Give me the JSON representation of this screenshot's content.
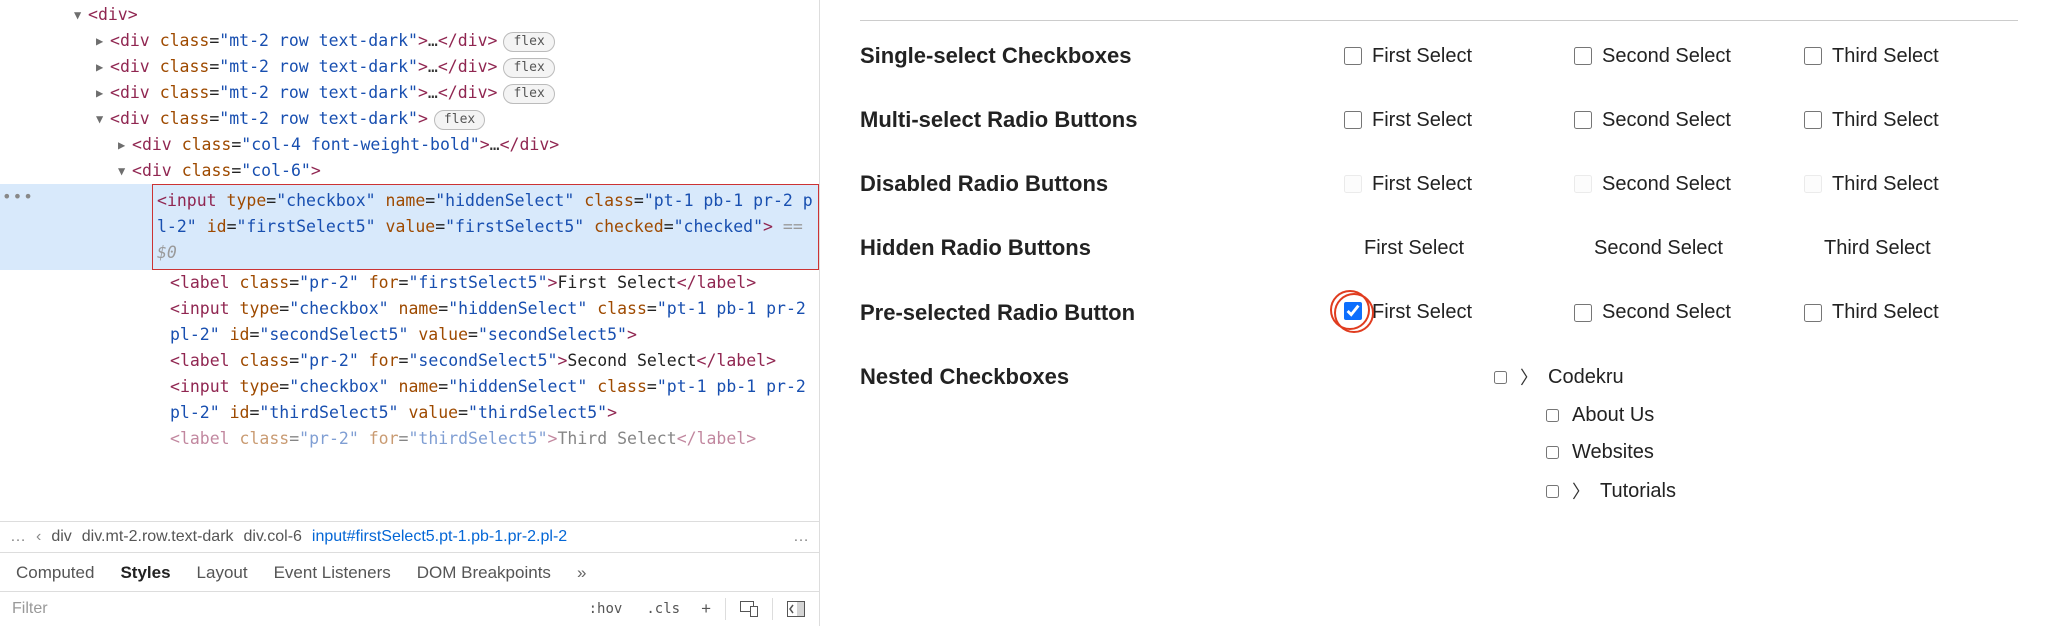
{
  "dom": {
    "root_open": "<div>",
    "rows": [
      {
        "open": "<div class=\"mt-2 row text-dark\">",
        "close": "</div>"
      },
      {
        "open": "<div class=\"mt-2 row text-dark\">",
        "close": "</div>"
      },
      {
        "open": "<div class=\"mt-2 row text-dark\">",
        "close": "</div>"
      },
      {
        "open": "<div class=\"mt-2 row text-dark\">",
        "close": ""
      }
    ],
    "child1": {
      "open": "<div class=\"col-4 font-weight-bold\">",
      "close": "</div>"
    },
    "child2_open": "<div class=\"col-6\">",
    "selected_input": "<input type=\"checkbox\" name=\"hiddenSelect\" class=\"pt-1 pb-1 pr-2 pl-2\" id=\"firstSelect5\" value=\"firstSelect5\" checked=\"checked\">",
    "ghost": " == $0",
    "label1": "<label class=\"pr-2\" for=\"firstSelect5\">First Select</label>",
    "input2": "<input type=\"checkbox\" name=\"hiddenSelect\" class=\"pt-1 pb-1 pr-2 pl-2\" id=\"secondSelect5\" value=\"secondSelect5\">",
    "label2": "<label class=\"pr-2\" for=\"secondSelect5\">Second Select</label>",
    "input3": "<input type=\"checkbox\" name=\"hiddenSelect\" class=\"pt-1 pb-1 pr-2 pl-2\" id=\"thirdSelect5\" value=\"thirdSelect5\">",
    "label3_partial": "<label class=\"pr-2\" for=\"thirdSelect5\">Third Select</label>",
    "flex_badge": "flex",
    "ellipsis": "…"
  },
  "crumbs": {
    "back": "‹",
    "items": [
      "div",
      "div.mt-2.row.text-dark",
      "div.col-6",
      "input#firstSelect5.pt-1.pb-1.pr-2.pl-2"
    ],
    "ell": "…"
  },
  "panel": {
    "tabs": [
      "Computed",
      "Styles",
      "Layout",
      "Event Listeners",
      "DOM Breakpoints"
    ],
    "more": "»",
    "filter_ph": "Filter",
    "hov": ":hov",
    "cls": ".cls",
    "plus": "+"
  },
  "form": {
    "rows": [
      {
        "label": "Single-select Checkboxes",
        "type": "cb",
        "opts": [
          "First Select",
          "Second Select",
          "Third Select"
        ],
        "checked": [
          false,
          false,
          false
        ],
        "disabled": false
      },
      {
        "label": "Multi-select Radio Buttons",
        "type": "cb",
        "opts": [
          "First Select",
          "Second Select",
          "Third Select"
        ],
        "checked": [
          false,
          false,
          false
        ],
        "disabled": false
      },
      {
        "label": "Disabled Radio Buttons",
        "type": "cb",
        "opts": [
          "First Select",
          "Second Select",
          "Third Select"
        ],
        "checked": [
          false,
          false,
          false
        ],
        "disabled": true
      },
      {
        "label": "Hidden Radio Buttons",
        "type": "text",
        "opts": [
          "First Select",
          "Second Select",
          "Third Select"
        ]
      },
      {
        "label": "Pre-selected Radio Button",
        "type": "cb",
        "opts": [
          "First Select",
          "Second Select",
          "Third Select"
        ],
        "checked": [
          true,
          false,
          false
        ],
        "disabled": false,
        "circle": 0
      }
    ],
    "nested": {
      "label": "Nested Checkboxes",
      "items": [
        {
          "text": "Codekru",
          "caret": true,
          "child": false
        },
        {
          "text": "About Us",
          "caret": false,
          "child": true
        },
        {
          "text": "Websites",
          "caret": false,
          "child": true
        },
        {
          "text": "Tutorials",
          "caret": true,
          "child": true
        }
      ]
    }
  }
}
